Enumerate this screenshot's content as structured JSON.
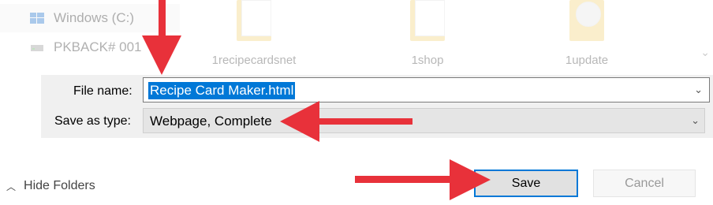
{
  "nav": {
    "items": [
      {
        "label": "Windows (C:)"
      },
      {
        "label": "PKBACK# 001"
      }
    ]
  },
  "files": [
    {
      "name": "1recipecardsnet"
    },
    {
      "name": "1shop"
    },
    {
      "name": "1update"
    }
  ],
  "form": {
    "file_name_label": "File name:",
    "file_name_value": "Recipe Card Maker.html",
    "save_type_label": "Save as type:",
    "save_type_value": "Webpage, Complete"
  },
  "footer": {
    "hide_folders_label": "Hide Folders",
    "save_label": "Save",
    "cancel_label": "Cancel"
  },
  "colors": {
    "accent": "#0078d7",
    "annotation_arrow": "#e8313a"
  }
}
